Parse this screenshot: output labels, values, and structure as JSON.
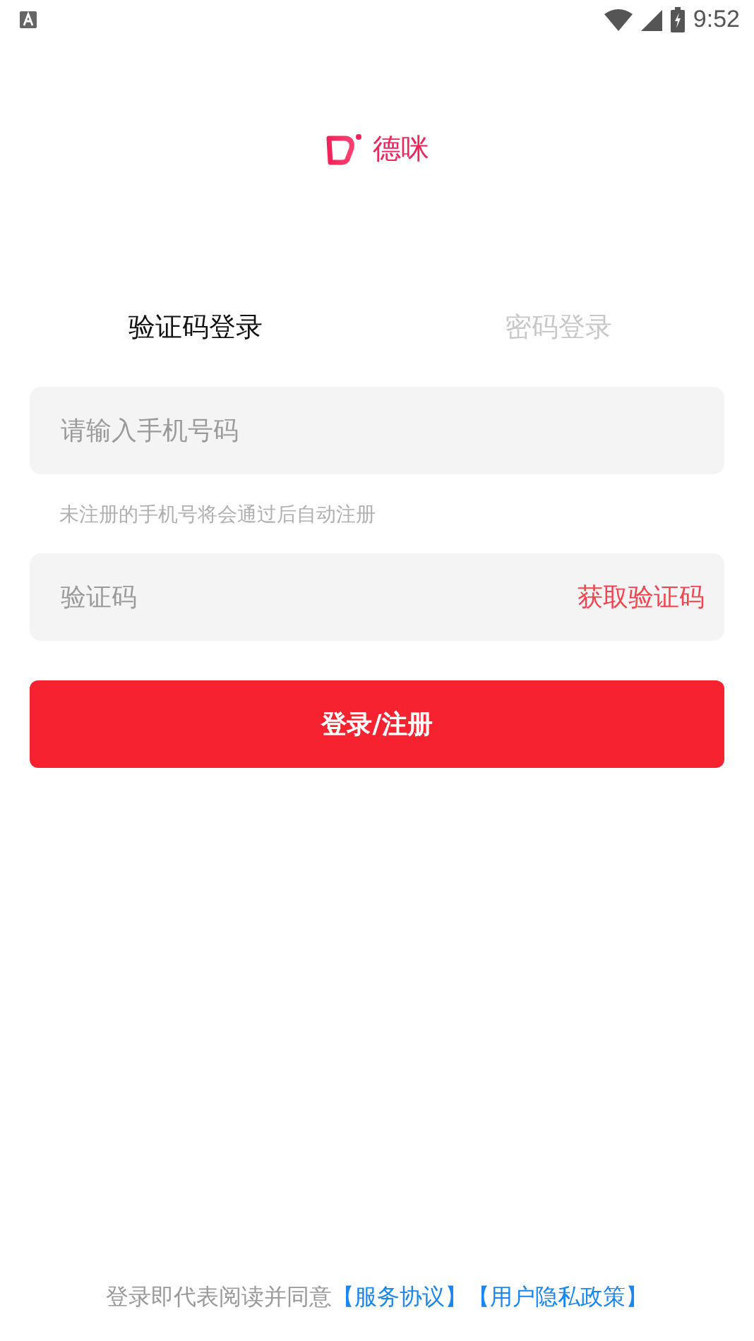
{
  "status_bar": {
    "time": "9:52"
  },
  "logo": {
    "name": "德咪"
  },
  "tabs": [
    {
      "label": "验证码登录",
      "selected": true
    },
    {
      "label": "密码登录",
      "selected": false
    }
  ],
  "phone_field": {
    "placeholder": "请输入手机号码"
  },
  "hint": "未注册的手机号将会通过后自动注册",
  "code_field": {
    "placeholder": "验证码",
    "action": "获取验证码"
  },
  "submit_button": "登录/注册",
  "footer": {
    "text": "登录即代表阅读并同意",
    "links": [
      "【服务协议】",
      "【用户隐私政策】"
    ]
  }
}
